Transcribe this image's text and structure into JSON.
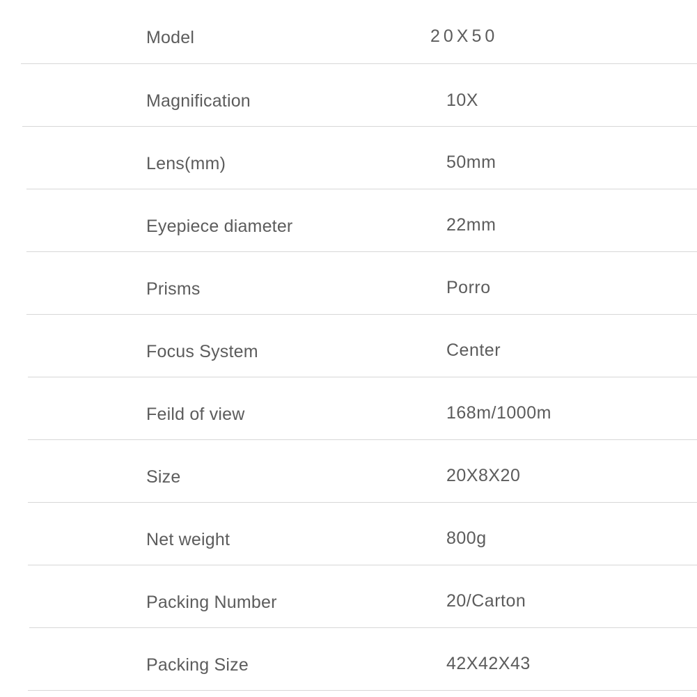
{
  "specs": [
    {
      "label": "Model",
      "value": "20X50"
    },
    {
      "label": "Magnification",
      "value": "10X"
    },
    {
      "label": "Lens(mm)",
      "value": "50mm"
    },
    {
      "label": "Eyepiece diameter",
      "value": "22mm"
    },
    {
      "label": "Prisms",
      "value": "Porro"
    },
    {
      "label": "Focus System",
      "value": "Center"
    },
    {
      "label": "Feild of view",
      "value": "168m/1000m"
    },
    {
      "label": "Size",
      "value": "20X8X20"
    },
    {
      "label": "Net weight",
      "value": "800g"
    },
    {
      "label": "Packing Number",
      "value": "20/Carton"
    },
    {
      "label": "Packing Size",
      "value": "42X42X43"
    }
  ]
}
